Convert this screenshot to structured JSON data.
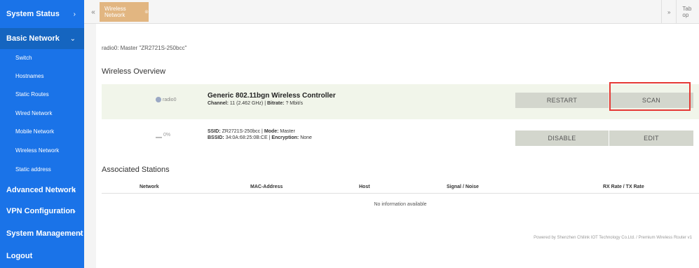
{
  "sidebar": {
    "items": [
      {
        "label": "System Status",
        "chevron": "›"
      },
      {
        "label": "Basic Network",
        "chevron": "⌄"
      },
      {
        "label": "Advanced Network",
        "chevron": "›"
      },
      {
        "label": "VPN Configuration",
        "chevron": "›"
      },
      {
        "label": "System Management",
        "chevron": "›"
      },
      {
        "label": "Logout",
        "chevron": ""
      }
    ],
    "subitems": [
      {
        "label": "Switch"
      },
      {
        "label": "Hostnames"
      },
      {
        "label": "Static Routes"
      },
      {
        "label": "Wired Network"
      },
      {
        "label": "Mobile Network"
      },
      {
        "label": "Wireless Network"
      },
      {
        "label": "Static address"
      }
    ]
  },
  "tabs": {
    "nav_left": "«",
    "nav_right": "»",
    "items": [
      {
        "label": "Wireless Network",
        "close": "⊗"
      }
    ],
    "options_label": "Tab op"
  },
  "page": {
    "breadcrumb": "radio0: Master \"ZR2721S-250bcc\"",
    "overview_title": "Wireless Overview",
    "controller": {
      "icon_label": "radio0",
      "title": "Generic 802.11bgn Wireless Controller",
      "channel_label": "Channel:",
      "channel_value": "11 (2.462 GHz)",
      "bitrate_label": "Bitrate:",
      "bitrate_value": "? Mbit/s",
      "separator": " | ",
      "restart_label": "RESTART",
      "scan_label": "SCAN"
    },
    "network": {
      "signal_label": "0%",
      "ssid_label": "SSID:",
      "ssid_value": "ZR2721S-250bcc",
      "mode_label": "Mode:",
      "mode_value": "Master",
      "bssid_label": "BSSID:",
      "bssid_value": "34:0A:68:25:0B:CE",
      "encryption_label": "Encryption:",
      "encryption_value": "None",
      "separator": " | ",
      "disable_label": "DISABLE",
      "edit_label": "EDIT"
    },
    "stations_title": "Associated Stations",
    "stations_columns": [
      "Network",
      "MAC-Address",
      "Host",
      "Signal / Noise",
      "RX Rate / TX Rate"
    ],
    "stations_empty": "No information available",
    "footer": "Powered by Shenzhen Chilink IOT Technology Co.Ltd. / Premium Wireless Router v1"
  },
  "colors": {
    "sidebar": "#1a73e8",
    "active_tab": "#e2b681",
    "highlight": "#e53935"
  }
}
